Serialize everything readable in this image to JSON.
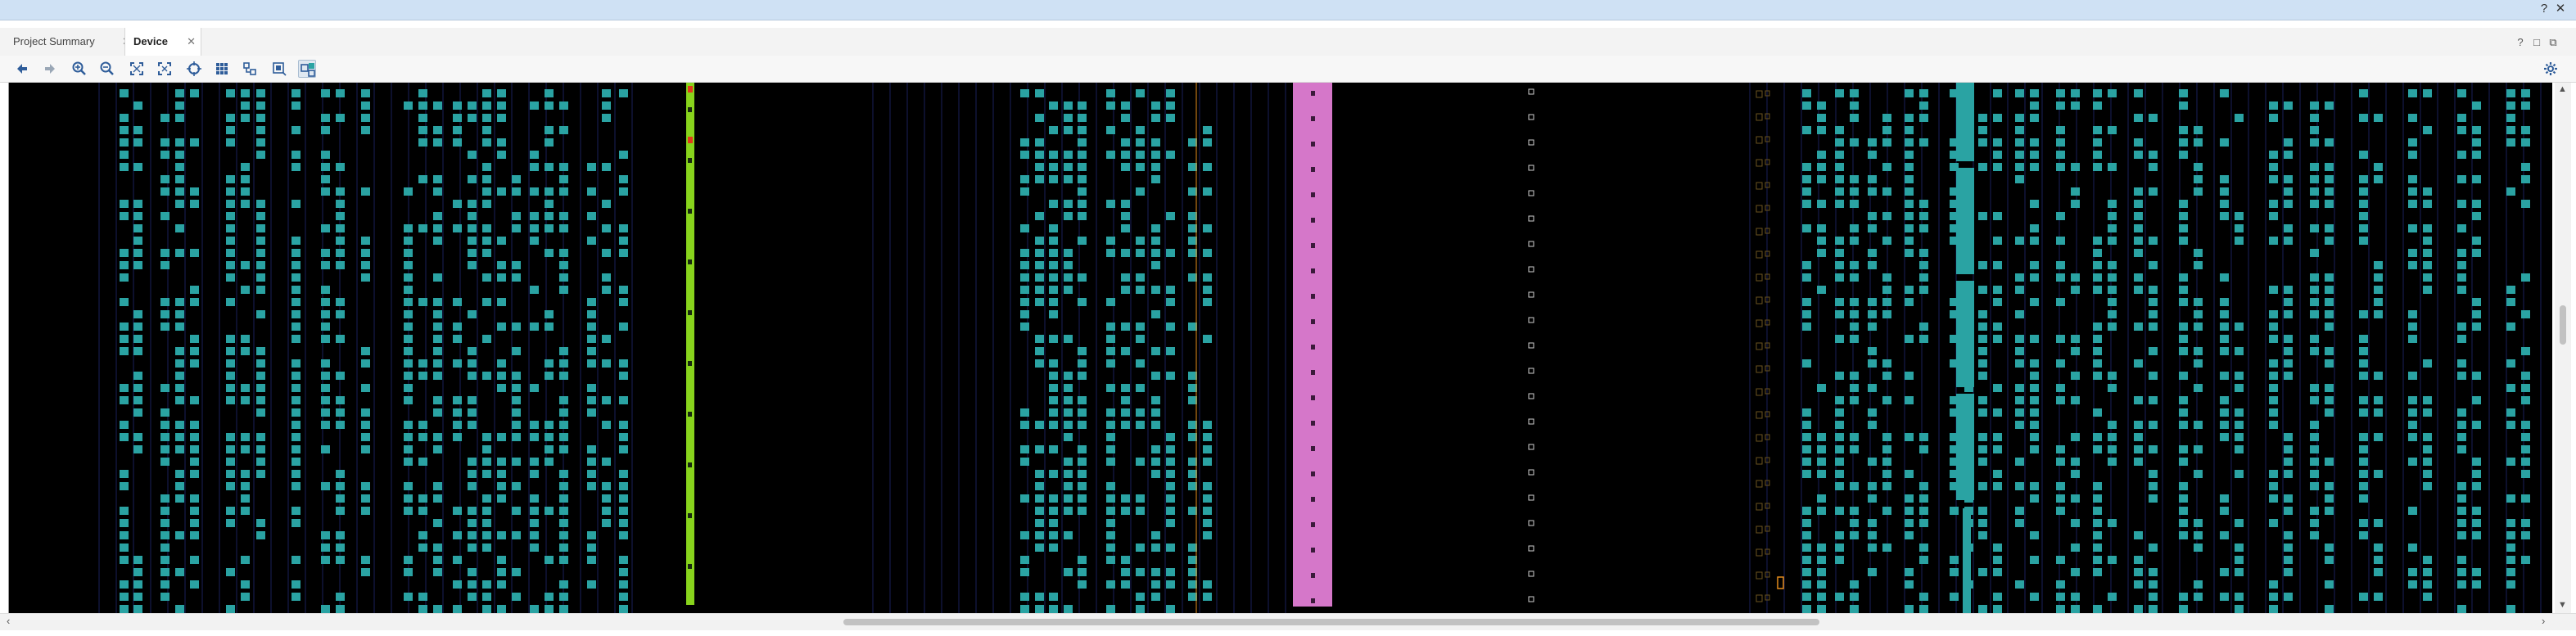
{
  "window": {
    "help_glyph": "?",
    "close_glyph": "✕"
  },
  "tabs": [
    {
      "label": "Project Summary",
      "active": false,
      "close_glyph": "✕"
    },
    {
      "label": "Device",
      "active": true,
      "close_glyph": "✕"
    }
  ],
  "panel_controls": {
    "help_glyph": "?",
    "restore_glyph": "□",
    "maximize_glyph": "⧉"
  },
  "toolbar": {
    "buttons": [
      {
        "name": "back-button",
        "icon": "arrow-left-icon"
      },
      {
        "name": "forward-button",
        "icon": "arrow-right-icon"
      },
      {
        "name": "zoom-in-button",
        "icon": "zoom-in-icon"
      },
      {
        "name": "zoom-out-button",
        "icon": "zoom-out-icon"
      },
      {
        "name": "zoom-fit-button",
        "icon": "zoom-fit-icon"
      },
      {
        "name": "zoom-area-button",
        "icon": "zoom-area-icon"
      },
      {
        "name": "autofit-selection-button",
        "icon": "crosshair-icon"
      },
      {
        "name": "clock-regions-button",
        "icon": "grid-icon"
      },
      {
        "name": "routing-resources-button",
        "icon": "routing-icon"
      },
      {
        "name": "select-area-button",
        "icon": "select-area-icon"
      },
      {
        "name": "highlight-cells-button",
        "icon": "highlight-cells-icon",
        "pressed": true
      }
    ],
    "settings_icon": "gear-icon"
  },
  "colors": {
    "device_background": "#000000",
    "site_used": "#2aa3a3",
    "site_outline": "#1a1f5a",
    "column_green": "#88d41c",
    "column_pink": "#d577c9",
    "highlight_orange": "#e38b1a"
  }
}
